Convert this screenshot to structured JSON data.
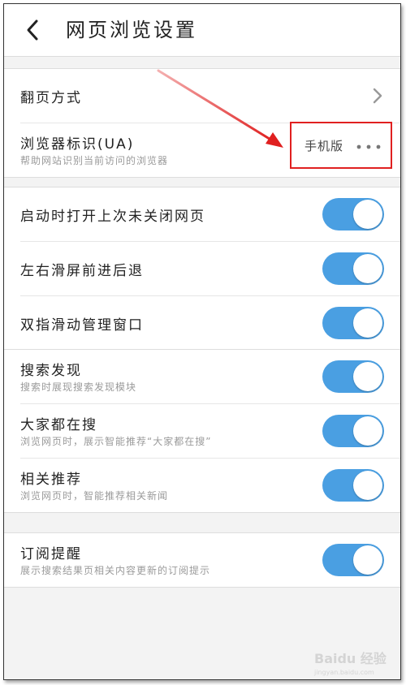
{
  "header": {
    "title": "网页浏览设置"
  },
  "page_turn": {
    "label": "翻页方式"
  },
  "ua": {
    "label": "浏览器标识(UA)",
    "description": "帮助网站识别当前访问的浏览器",
    "value": "手机版"
  },
  "toggles": [
    {
      "label": "启动时打开上次未关闭网页",
      "on": true
    },
    {
      "label": "左右滑屏前进后退",
      "on": true
    },
    {
      "label": "双指滑动管理窗口",
      "on": true
    }
  ],
  "discovery": [
    {
      "label": "搜索发现",
      "description": "搜索时展现搜索发现模块",
      "on": true
    },
    {
      "label": "大家都在搜",
      "description": "浏览网页时，展示智能推荐“大家都在搜”",
      "on": true
    },
    {
      "label": "相关推荐",
      "description": "浏览网页时，智能推荐相关新闻",
      "on": true
    }
  ],
  "subscription": {
    "label": "订阅提醒",
    "description": "展示搜索结果页相关内容更新的订阅提示",
    "on": true
  },
  "watermark": "Baidu 经验",
  "colors": {
    "toggle_on": "#4a9fe2",
    "annotation_red": "#e02020"
  }
}
